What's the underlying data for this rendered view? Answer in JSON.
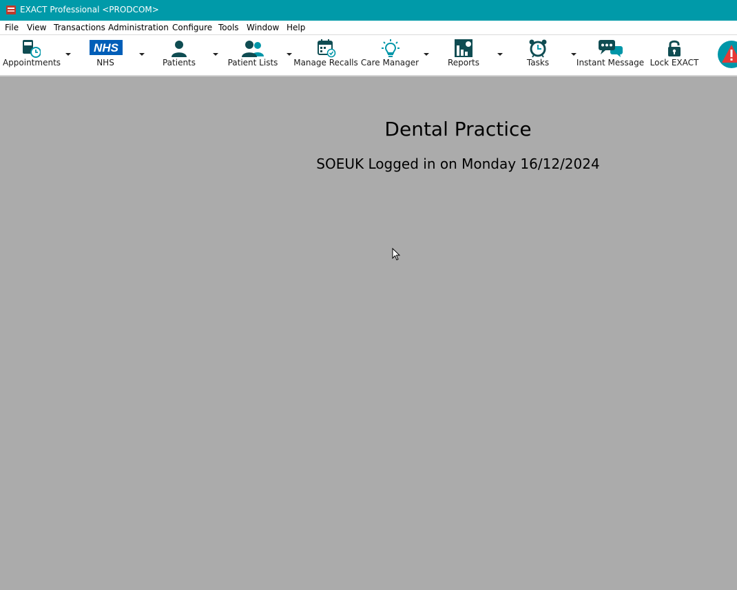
{
  "window": {
    "title": "EXACT Professional <PRODCOM>"
  },
  "menubar": {
    "items": [
      "File",
      "View",
      "Transactions",
      "Administration",
      "Configure",
      "Tools",
      "Window",
      "Help"
    ]
  },
  "toolbar": {
    "appointments": "Appointments",
    "nhs": "NHS",
    "patients": "Patients",
    "patient_lists": "Patient Lists",
    "manage_recalls": "Manage Recalls",
    "care_manager": "Care Manager",
    "reports": "Reports",
    "tasks": "Tasks",
    "instant_message": "Instant Message",
    "lock_exact": "Lock EXACT",
    "nhs_logo_text": "NHS",
    "icon_color": "#0f4c52",
    "accent_color": "#0096a8",
    "alert_color": "#e53935"
  },
  "main": {
    "title": "Dental Practice",
    "login_status": "SOEUK Logged in on Monday 16/12/2024"
  },
  "colors": {
    "titlebar": "#009aa9",
    "desktop": "#ababab"
  }
}
